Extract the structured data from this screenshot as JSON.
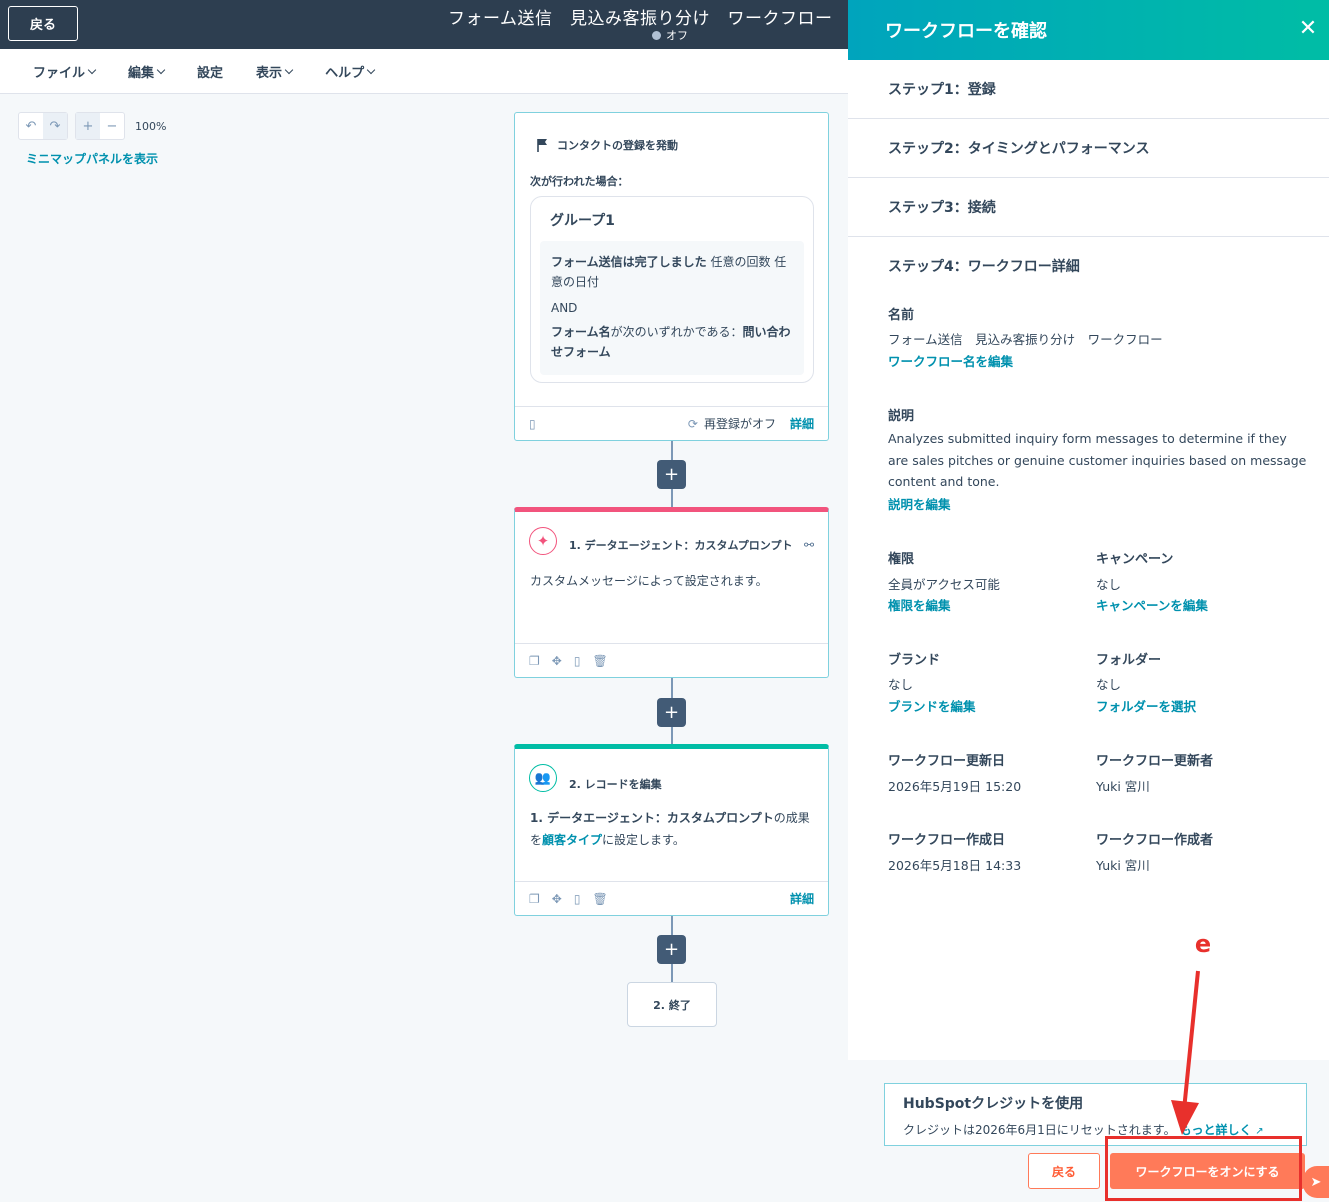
{
  "topbar": {
    "back_label": "戻る",
    "title": "フォーム送信　見込み客振り分け　ワークフロー",
    "status": "オフ"
  },
  "menu": {
    "items": [
      "ファイル",
      "編集",
      "設定",
      "表示",
      "ヘルプ"
    ]
  },
  "canvas": {
    "undo": "↶",
    "redo": "↷",
    "zoom_in": "+",
    "zoom_out": "−",
    "zoom_level": "100%",
    "minimap_link": "ミニマップパネルを表示"
  },
  "trigger": {
    "title": "コンタクトの登録を発動",
    "condition_label": "次が行われた場合：",
    "group_title": "グループ1",
    "cond1_bold": "フォーム送信は完了しました",
    "cond1_rest": "任意の回数 任意の日付",
    "and_label": "AND",
    "cond2_bold": "フォーム名",
    "cond2_mid": "が次のいずれかである：",
    "cond2_value": "問い合わせフォーム",
    "reenroll": "再登録がオフ",
    "details": "詳細"
  },
  "action1": {
    "title": "1. データエージェント：カスタムプロンプト",
    "body": "カスタムメッセージによって設定されます。",
    "accent": "#f2547d"
  },
  "action2": {
    "title": "2. レコードを編集",
    "body_bold": "1. データエージェント：カスタムプロンプト",
    "body_mid1": "の成果を",
    "body_link": "顧客タイプ",
    "body_mid2": "に設定します。",
    "details": "詳細",
    "accent": "#00bda5"
  },
  "end_node": {
    "label": "2. 終了"
  },
  "panel": {
    "title": "ワークフローを確認",
    "steps": [
      "ステップ1：登録",
      "ステップ2：タイミングとパフォーマンス",
      "ステップ3：接続",
      "ステップ4：ワークフロー詳細"
    ],
    "name_label": "名前",
    "name_value": "フォーム送信　見込み客振り分け　ワークフロー",
    "name_edit": "ワークフロー名を編集",
    "desc_label": "説明",
    "desc_value": "Analyzes submitted inquiry form messages to determine if they are sales pitches or genuine customer inquiries based on message content and tone.",
    "desc_edit": "説明を編集",
    "perm_label": "権限",
    "perm_value": "全員がアクセス可能",
    "perm_edit": "権限を編集",
    "campaign_label": "キャンペーン",
    "campaign_value": "なし",
    "campaign_edit": "キャンペーンを編集",
    "brand_label": "ブランド",
    "brand_value": "なし",
    "brand_edit": "ブランドを編集",
    "folder_label": "フォルダー",
    "folder_value": "なし",
    "folder_edit": "フォルダーを選択",
    "updated_label": "ワークフロー更新日",
    "updated_value": "2026年5月19日 15:20",
    "updater_label": "ワークフロー更新者",
    "updater_value": "Yuki 宮川",
    "created_label": "ワークフロー作成日",
    "created_value": "2026年5月18日 14:33",
    "creator_label": "ワークフロー作成者",
    "creator_value": "Yuki 宮川"
  },
  "footer": {
    "credit_title": "HubSpotクレジットを使用",
    "credit_text": "クレジットは2026年6月1日にリセットされます。",
    "credit_link": "もっと詳しく",
    "back_label": "戻る",
    "turn_on_label": "ワークフローをオンにする"
  },
  "annotation": {
    "letter": "e"
  }
}
